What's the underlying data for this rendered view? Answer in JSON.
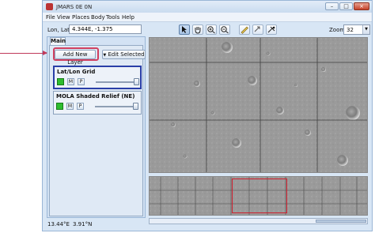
{
  "window": {
    "title": "JMARS 0E 0N"
  },
  "menubar": {
    "items": [
      "File",
      "View",
      "Places",
      "Body",
      "Tools",
      "Help"
    ]
  },
  "location": {
    "label": "Lon, Lat",
    "value": "4.344E, -1.375"
  },
  "zoom": {
    "label": "Zoom:",
    "value": "32"
  },
  "layer_manager": {
    "tab": "Main",
    "add_layer_label": "Add New Layer",
    "edit_selected_label": "Edit Selected",
    "edit_selected_arrow": "▼",
    "layers": [
      {
        "name": "Lat/Lon Grid",
        "m": "M",
        "p": "P",
        "opacity_fraction": 1.0,
        "active": true
      },
      {
        "name": "MOLA Shaded Relief (NE)",
        "m": "M",
        "p": "P",
        "opacity_fraction": 1.0,
        "active": false
      }
    ]
  },
  "status": {
    "lon": "13.44°E",
    "lat": "3.91°N"
  },
  "colors": {
    "highlight": "#d04060",
    "active_layer_border": "#2a3fa8",
    "visible_check": "#2fbd2f"
  }
}
